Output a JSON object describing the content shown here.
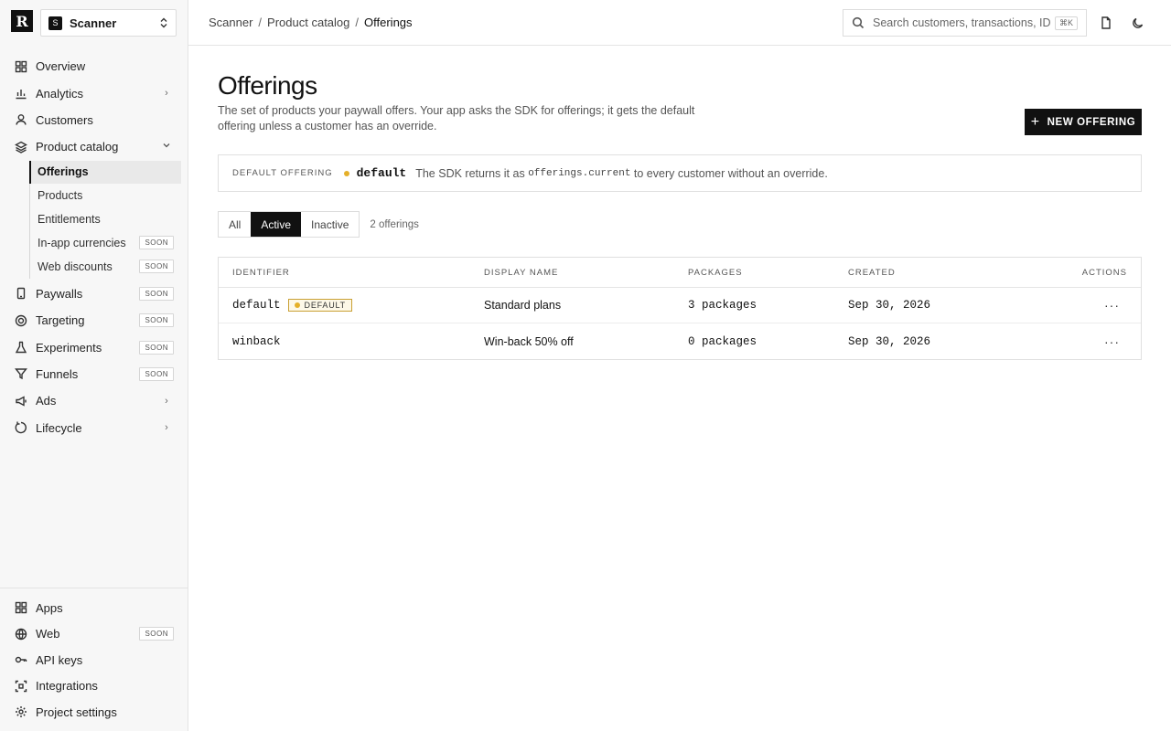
{
  "sidebar": {
    "logo_letter": "R",
    "project": {
      "badge": "S",
      "name": "Scanner"
    },
    "items": [
      {
        "label": "Overview",
        "icon": "grid-icon"
      },
      {
        "label": "Analytics",
        "icon": "bar-chart-icon",
        "chevron": "›"
      },
      {
        "label": "Customers",
        "icon": "user-icon"
      },
      {
        "label": "Product catalog",
        "icon": "layers-icon",
        "chevron": "⌄"
      }
    ],
    "sub_items": [
      {
        "label": "Offerings",
        "active": true
      },
      {
        "label": "Products"
      },
      {
        "label": "Entitlements"
      },
      {
        "label": "In-app currencies",
        "badge": "SOON"
      },
      {
        "label": "Web discounts",
        "badge": "SOON"
      }
    ],
    "items_after": [
      {
        "label": "Paywalls",
        "icon": "phone-icon",
        "badge": "SOON"
      },
      {
        "label": "Targeting",
        "icon": "target-icon",
        "badge": "SOON"
      },
      {
        "label": "Experiments",
        "icon": "flask-icon",
        "badge": "SOON"
      },
      {
        "label": "Funnels",
        "icon": "funnel-icon",
        "badge": "SOON"
      },
      {
        "label": "Ads",
        "icon": "megaphone-icon",
        "chevron": "›"
      },
      {
        "label": "Lifecycle",
        "icon": "cycle-icon",
        "chevron": "›"
      }
    ],
    "bottom_items": [
      {
        "label": "Apps",
        "icon": "apps-icon"
      },
      {
        "label": "Web",
        "icon": "globe-icon",
        "badge": "SOON"
      },
      {
        "label": "API keys",
        "icon": "key-icon"
      },
      {
        "label": "Integrations",
        "icon": "integrations-icon"
      },
      {
        "label": "Project settings",
        "icon": "settings-icon"
      }
    ]
  },
  "topbar": {
    "breadcrumb": [
      "Scanner",
      "Product catalog",
      "Offerings"
    ],
    "breadcrumb_sep": "/",
    "search_placeholder": "Search customers, transactions, IDs",
    "search_shortcut": "⌘K"
  },
  "page": {
    "title": "Offerings",
    "description": "The set of products your paywall offers. Your app asks the SDK for offerings; it gets the default offering unless a customer has an override.",
    "new_button": "NEW OFFERING",
    "new_button_icon": "+",
    "default_offering": {
      "eyebrow": "DEFAULT OFFERING",
      "identifier": "default",
      "text_before": "The SDK returns it as",
      "code": "offerings.current",
      "text_after": "to every customer without an override."
    },
    "filters": [
      "All",
      "Active",
      "Inactive"
    ],
    "active_filter": "Active",
    "count": "2 offerings"
  },
  "table": {
    "columns": [
      "IDENTIFIER",
      "DISPLAY NAME",
      "PACKAGES",
      "CREATED",
      "ACTIONS"
    ],
    "rows": [
      {
        "identifier": "default",
        "badge": "DEFAULT",
        "display_name": "Standard plans",
        "packages": "3 packages",
        "created": "Sep 30, 2026",
        "actions": "···"
      },
      {
        "identifier": "winback",
        "display_name": "Win-back 50% off",
        "packages": "0 packages",
        "created": "Sep 30, 2026",
        "actions": "···"
      }
    ]
  },
  "colors": {
    "accent": "#111111",
    "default_dot": "#e5b02a",
    "badge_border": "#c9a033"
  }
}
